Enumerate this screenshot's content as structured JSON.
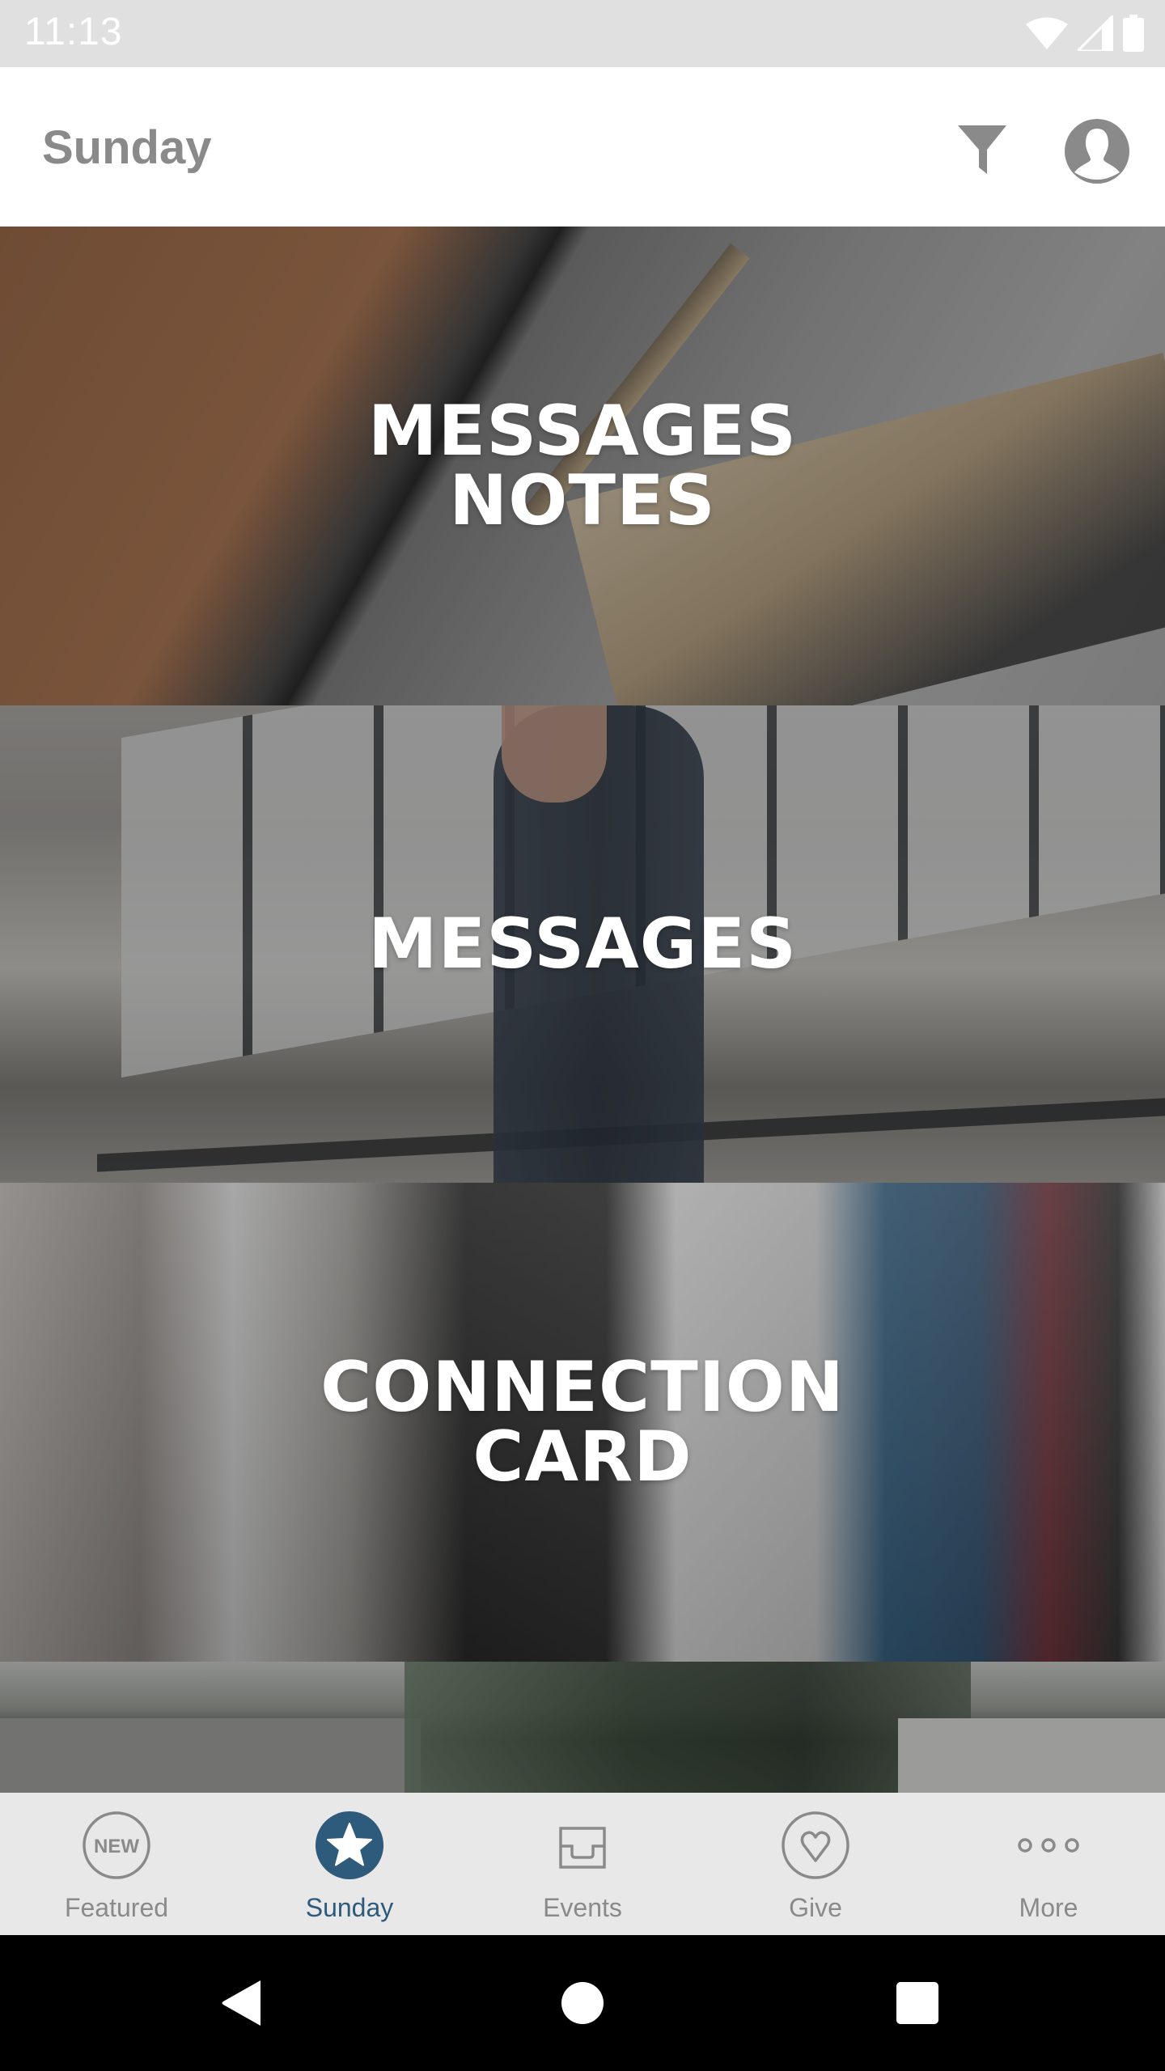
{
  "status_bar": {
    "time": "11:13",
    "icons": [
      "wifi-icon",
      "cellular-signal-icon",
      "battery-icon"
    ]
  },
  "app_bar": {
    "title": "Sunday",
    "actions": [
      {
        "name": "filter",
        "icon": "filter-icon"
      },
      {
        "name": "profile",
        "icon": "account-circle-icon"
      }
    ]
  },
  "tiles": [
    {
      "title_lines": [
        "MESSAGES",
        "NOTES"
      ]
    },
    {
      "title_lines": [
        "MESSAGES"
      ]
    },
    {
      "title_lines": [
        "CONNECTION",
        "CARD"
      ]
    },
    {
      "title_lines": []
    }
  ],
  "bottom_nav": {
    "active_index": 1,
    "active_color": "#2e5a7c",
    "inactive_color": "#8a8a8a",
    "items": [
      {
        "label": "Featured",
        "icon": "new-badge-icon",
        "badge_text": "NEW"
      },
      {
        "label": "Sunday",
        "icon": "star-circle-icon"
      },
      {
        "label": "Events",
        "icon": "inbox-tray-icon"
      },
      {
        "label": "Give",
        "icon": "heart-circle-icon"
      },
      {
        "label": "More",
        "icon": "more-dots-icon"
      }
    ]
  },
  "system_nav": {
    "buttons": [
      "back-icon",
      "home-icon",
      "recents-icon"
    ]
  }
}
